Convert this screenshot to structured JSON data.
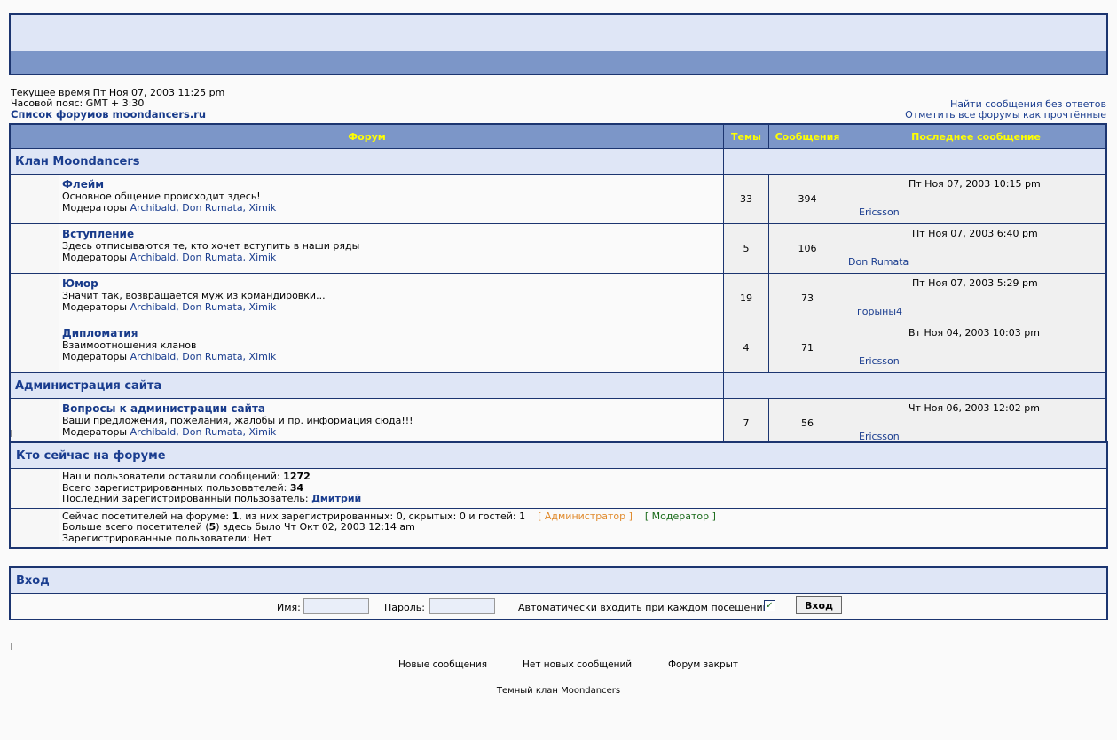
{
  "info": {
    "current_time": "Текущее время Пт Ноя 07, 2003 11:25 pm",
    "timezone": "Часовой пояс: GMT + 3:30",
    "index_link": "Список форумов moondancers.ru",
    "unanswered_link": "Найти сообщения без ответов",
    "mark_read_link": "Отметить все форумы как прочтённые"
  },
  "table": {
    "headers": {
      "forum": "Форум",
      "topics": "Темы",
      "posts": "Сообщения",
      "last_post": "Последнее сообщение"
    },
    "categories": [
      {
        "name": "Клан Moondancers",
        "forums": [
          {
            "title": "Флейм",
            "desc": "Основное общение происходит здесь!",
            "mod_label": "Модераторы",
            "mods": "Archibald, Don Rumata, Ximik",
            "topics": "33",
            "posts": "394",
            "last_date": "Пт Ноя 07, 2003 10:15 pm",
            "last_author": "Ericsson"
          },
          {
            "title": "Вступление",
            "desc": "Здесь отписываются те, кто хочет вступить в наши ряды",
            "mod_label": "Модераторы",
            "mods": "Archibald, Don Rumata, Ximik",
            "topics": "5",
            "posts": "106",
            "last_date": "Пт Ноя 07, 2003 6:40 pm",
            "last_author": "Don Rumata"
          },
          {
            "title": "Юмор",
            "desc": "Значит так, возвращается муж из командировки...",
            "mod_label": "Модераторы",
            "mods": "Archibald, Don Rumata, Ximik",
            "topics": "19",
            "posts": "73",
            "last_date": "Пт Ноя 07, 2003 5:29 pm",
            "last_author": "горыны4"
          },
          {
            "title": "Дипломатия",
            "desc": "Взаимоотношения кланов",
            "mod_label": "Модераторы",
            "mods": "Archibald, Don Rumata, Ximik",
            "topics": "4",
            "posts": "71",
            "last_date": "Вт Ноя 04, 2003 10:03 pm",
            "last_author": "Ericsson"
          }
        ]
      },
      {
        "name": "Администрация сайта",
        "forums": [
          {
            "title": "Вопросы к администрации сайта",
            "desc": "Ваши предложения, пожелания, жалобы и пр. информация сюда!!!",
            "mod_label": "Модераторы",
            "mods": "Archibald, Don Rumata, Ximik",
            "topics": "7",
            "posts": "56",
            "last_date": "Чт Ноя 06, 2003 12:02 pm",
            "last_author": "Ericsson"
          }
        ]
      }
    ]
  },
  "online": {
    "title": "Кто сейчас на форуме",
    "posts_label": "Наши пользователи оставили сообщений:",
    "posts_count": "1272",
    "users_label": "Всего зарегистрированных пользователей:",
    "users_count": "34",
    "newest_label": "Последний зарегистрированный пользователь:",
    "newest_user": "Дмитрий",
    "now_prefix": "Сейчас посетителей на форуме:",
    "now_count": "1",
    "now_suffix": ", из них зарегистрированных: 0, скрытых: 0 и гостей: 1",
    "admin_legend": "[ Администратор ]",
    "mod_legend": "[ Модератор ]",
    "record_prefix": "Больше всего посетителей (",
    "record_count": "5",
    "record_suffix": ") здесь было Чт Окт 02, 2003 12:14 am",
    "registered_line": "Зарегистрированные пользователи: Нет"
  },
  "login": {
    "title": "Вход",
    "username_label": "Имя:",
    "password_label": "Пароль:",
    "autologin_label": "Автоматически входить при каждом посещении",
    "autologin_checked": true,
    "submit_label": "Вход"
  },
  "legend": {
    "new_posts": "Новые сообщения",
    "no_new_posts": "Нет новых сообщений",
    "locked": "Форум закрыт"
  },
  "footer": {
    "text": "Темный клан Moondancers"
  },
  "colors": {
    "border": "#1c3570",
    "header_bar": "#7c96c8",
    "light": "#dfe6f6",
    "header_text": "#ffff00"
  }
}
